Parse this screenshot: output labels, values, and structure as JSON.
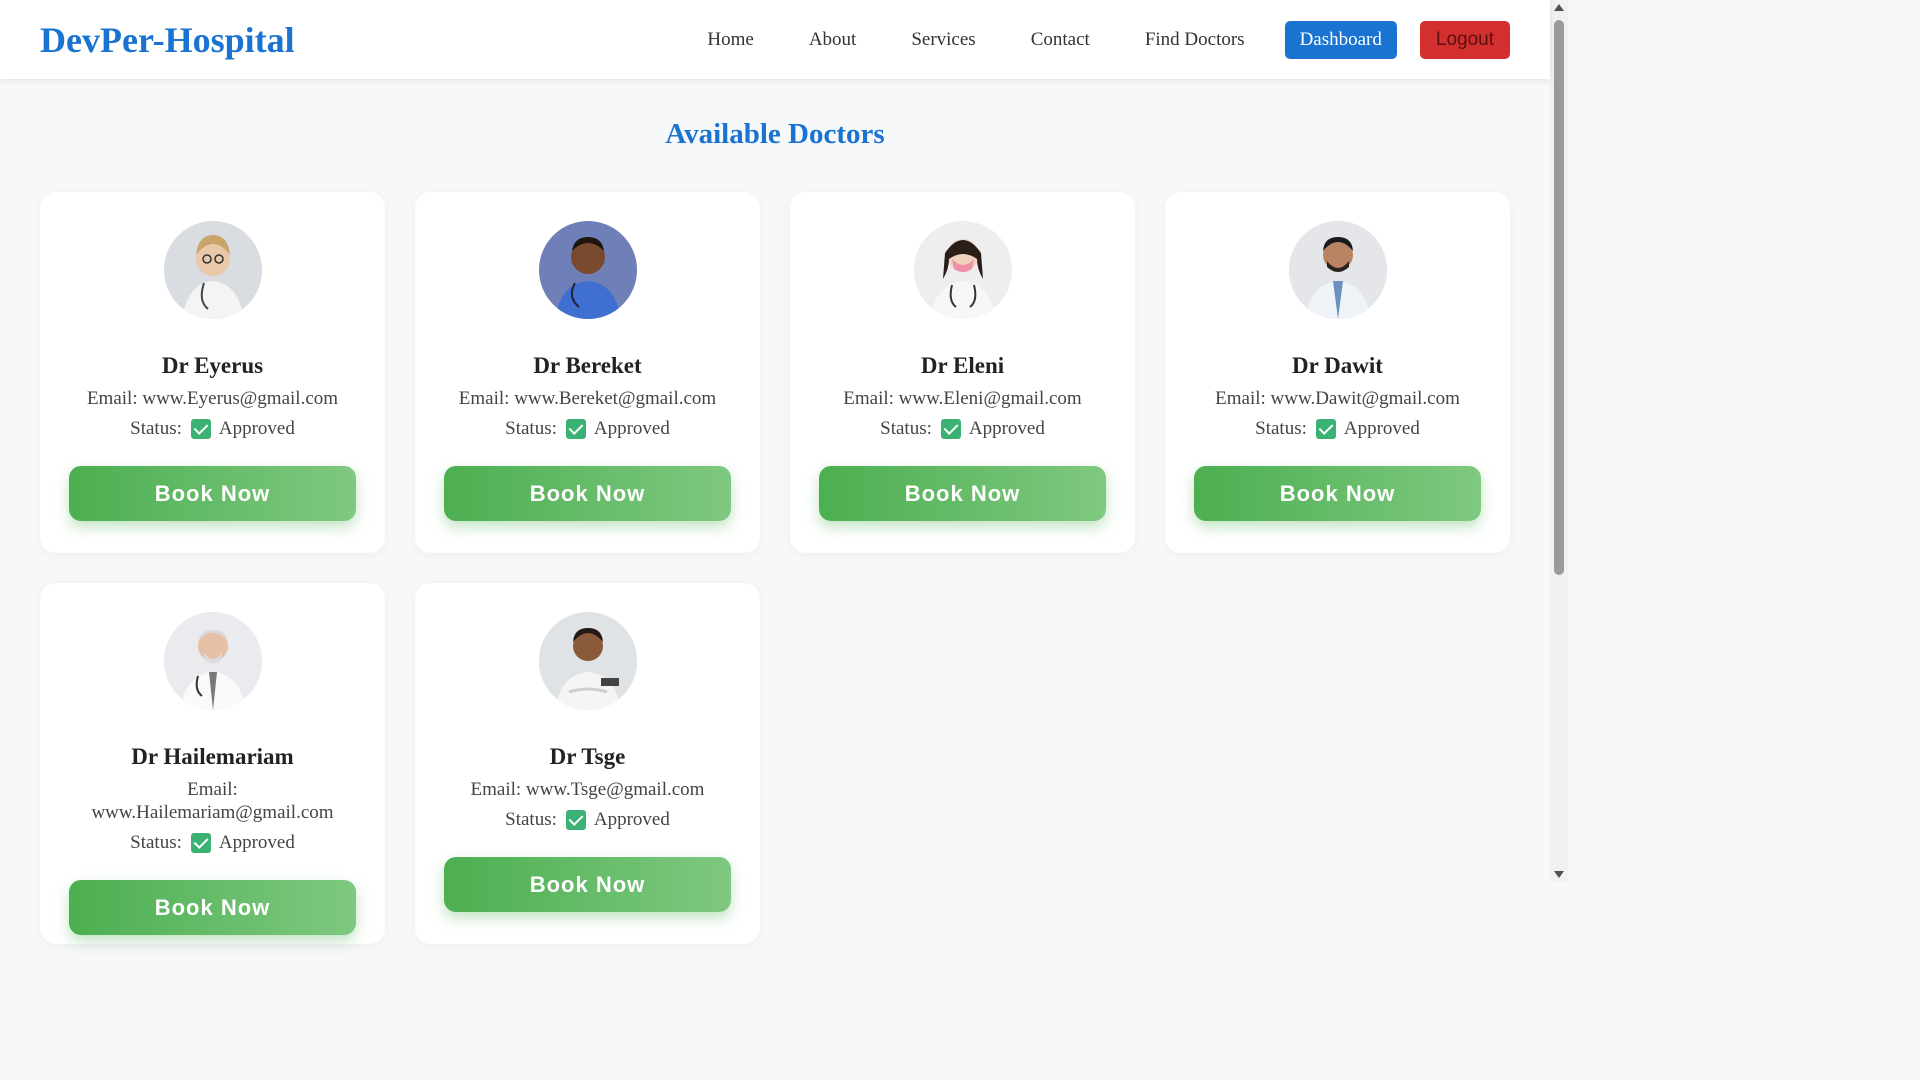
{
  "navbar": {
    "brand": "DevPer-Hospital",
    "links": [
      "Home",
      "About",
      "Services",
      "Contact",
      "Find Doctors"
    ],
    "dashboard_label": "Dashboard",
    "logout_label": "Logout"
  },
  "page": {
    "title": "Available Doctors"
  },
  "doctors": [
    {
      "name": "Dr Eyerus",
      "email": "Email: www.Eyerus@gmail.com",
      "status_label": "Status:",
      "status": "Approved",
      "button": "Book Now"
    },
    {
      "name": "Dr Bereket",
      "email": "Email: www.Bereket@gmail.com",
      "status_label": "Status:",
      "status": "Approved",
      "button": "Book Now"
    },
    {
      "name": "Dr Eleni",
      "email": "Email: www.Eleni@gmail.com",
      "status_label": "Status:",
      "status": "Approved",
      "button": "Book Now"
    },
    {
      "name": "Dr Dawit",
      "email": "Email: www.Dawit@gmail.com",
      "status_label": "Status:",
      "status": "Approved",
      "button": "Book Now"
    },
    {
      "name": "Dr Hailemariam",
      "email": "Email: www.Hailemariam@gmail.com",
      "status_label": "Status:",
      "status": "Approved",
      "button": "Book Now"
    },
    {
      "name": "Dr Tsge",
      "email": "Email: www.Tsge@gmail.com",
      "status_label": "Status:",
      "status": "Approved",
      "button": "Book Now"
    }
  ],
  "colors": {
    "brand": "#1a73d1",
    "logout": "#d32f2f",
    "book_button": "#4caf50",
    "approved_check": "#3bb273"
  }
}
